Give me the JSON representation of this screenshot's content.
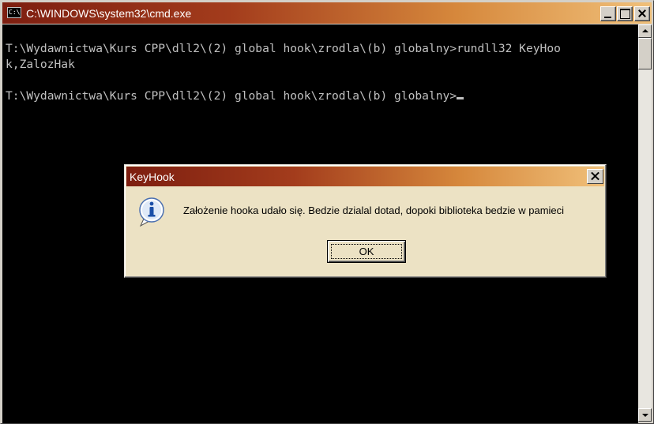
{
  "window": {
    "title": "C:\\WINDOWS\\system32\\cmd.exe",
    "icon_text": "C:\\"
  },
  "console": {
    "lines": [
      "T:\\Wydawnictwa\\Kurs CPP\\dll2\\(2) global hook\\zrodla\\(b) globalny>rundll32 KeyHoo",
      "k,ZalozHak",
      "",
      "T:\\Wydawnictwa\\Kurs CPP\\dll2\\(2) global hook\\zrodla\\(b) globalny>"
    ]
  },
  "dialog": {
    "title": "KeyHook",
    "message": "Założenie hooka udało się. Bedzie dzialal dotad, dopoki biblioteka bedzie w pamieci",
    "ok_label": "OK",
    "icon": "info-icon"
  },
  "colors": {
    "titlebar_start": "#7d1e10",
    "titlebar_end": "#f0c07a",
    "console_bg": "#000000",
    "console_fg": "#c0c0c0",
    "dialog_bg": "#ece2c4"
  }
}
